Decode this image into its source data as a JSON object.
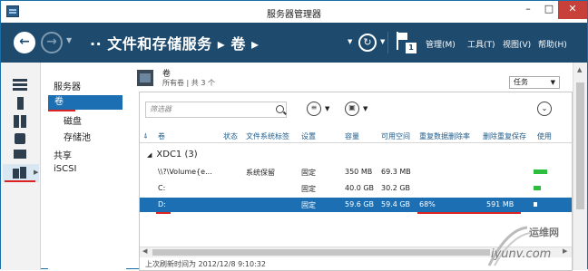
{
  "window": {
    "title": "服务器管理器",
    "minimize": "–",
    "maximize": "□",
    "close": "✕"
  },
  "header": {
    "breadcrumb": "·· 文件和存储服务 ▸ 卷 ▸",
    "notification_count": "1",
    "menus": [
      "管理(M)",
      "工具(T)",
      "视图(V)",
      "帮助(H)"
    ]
  },
  "sidebar": {
    "icons": [
      "dashboard-icon",
      "server-icon",
      "servers-icon",
      "roles-icon",
      "iis-icon",
      "storage-icon"
    ]
  },
  "subnav": {
    "items": [
      {
        "label": "服务器"
      },
      {
        "label": "卷"
      },
      {
        "label": "磁盘"
      },
      {
        "label": "存储池"
      },
      {
        "label": "共享"
      },
      {
        "label": "iSCSI"
      }
    ]
  },
  "panel": {
    "title": "卷",
    "subtitle": "所有卷 | 共 3 个",
    "tasks_label": "任务",
    "filter_placeholder": "筛选器",
    "columns": [
      "卷",
      "状态",
      "文件系统标签",
      "设置",
      "容量",
      "可用空间",
      "重复数据删除率",
      "删除重复保存",
      "使用"
    ],
    "group": {
      "name": "XDC1 (3)"
    },
    "rows": [
      {
        "volume": "\\\\?\\Volume{e...",
        "status": "",
        "label": "系统保留",
        "setting": "固定",
        "capacity": "350 MB",
        "free": "69.3 MB",
        "dedup_rate": "",
        "dedup_saved": "",
        "usage_fraction": 0.8
      },
      {
        "volume": "C:",
        "status": "",
        "label": "",
        "setting": "固定",
        "capacity": "40.0 GB",
        "free": "30.2 GB",
        "dedup_rate": "",
        "dedup_saved": "",
        "usage_fraction": 0.25
      },
      {
        "volume": "D:",
        "status": "",
        "label": "",
        "setting": "固定",
        "capacity": "59.6 GB",
        "free": "59.4 GB",
        "dedup_rate": "68%",
        "dedup_saved": "591 MB",
        "usage_fraction": 0.01
      }
    ],
    "footer": "上次刷新时间为 2012/12/8 9:10:32"
  },
  "watermark": {
    "brand": "运维网",
    "url": "iyunv.com"
  },
  "colors": {
    "header": "#1d4a6d",
    "selection": "#1d6fb3",
    "usage_bar": "#2cbf3e",
    "annotation": "#dd2222"
  }
}
